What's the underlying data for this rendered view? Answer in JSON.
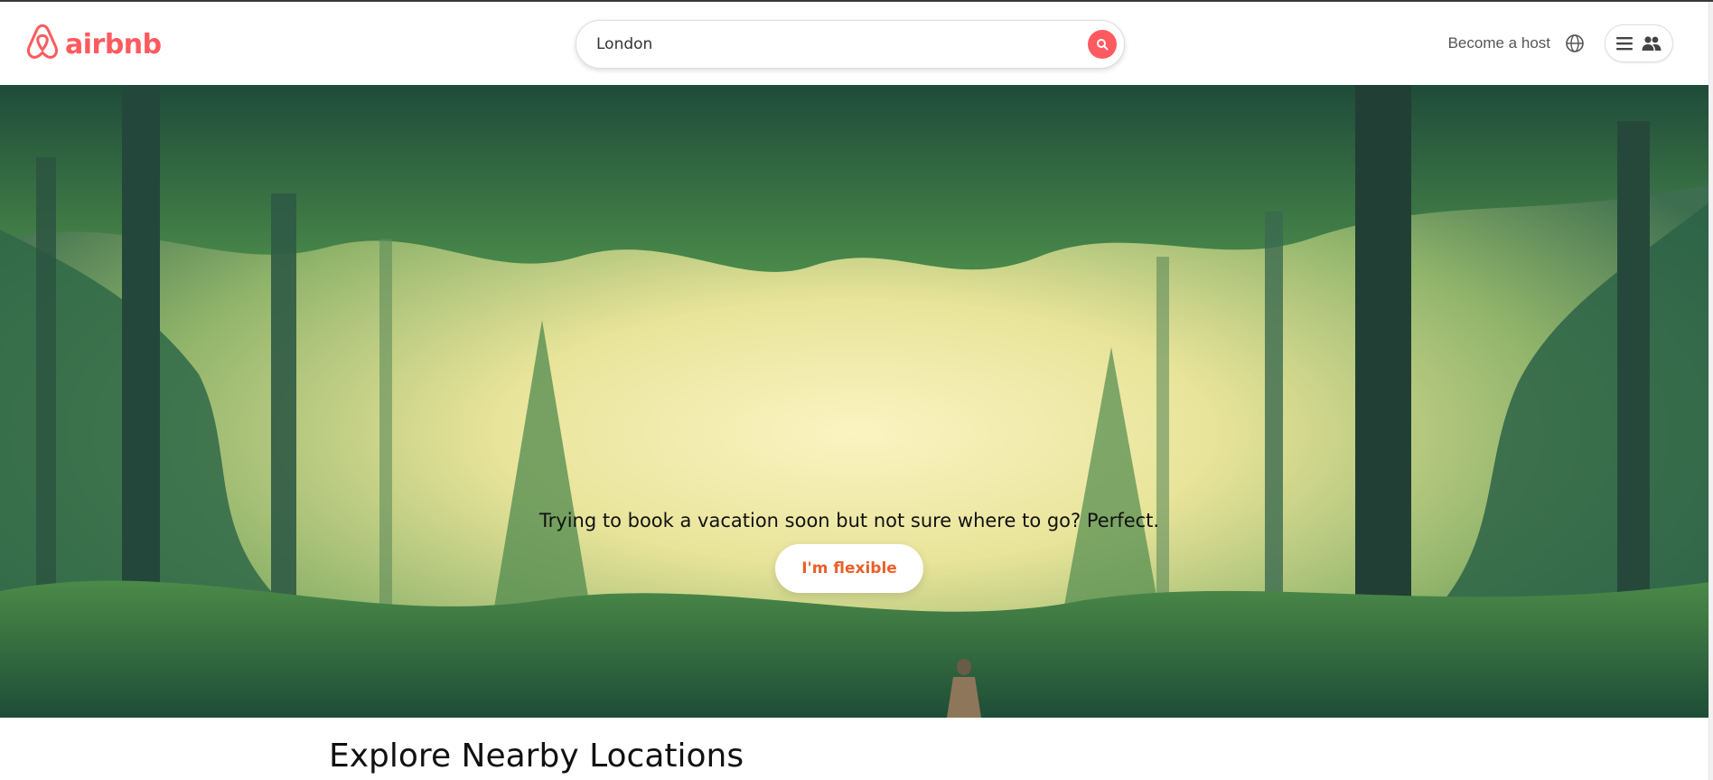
{
  "brand": {
    "name": "airbnb",
    "color": "#ff5a5f",
    "logo_icon": "airbnb-belo-icon"
  },
  "search": {
    "value": "London",
    "button_icon": "search-icon"
  },
  "nav": {
    "become_host": "Become a host",
    "language_icon": "globe-icon",
    "menu_icon": "hamburger-icon",
    "profile_icon": "users-icon"
  },
  "hero": {
    "tagline": "Trying to book a vacation soon but not sure where to go? Perfect.",
    "cta_label": "I'm flexible",
    "cta_color": "#e9602b",
    "image_description_icon": "forest-illustration"
  },
  "sections": {
    "explore_title": "Explore Nearby Locations"
  }
}
